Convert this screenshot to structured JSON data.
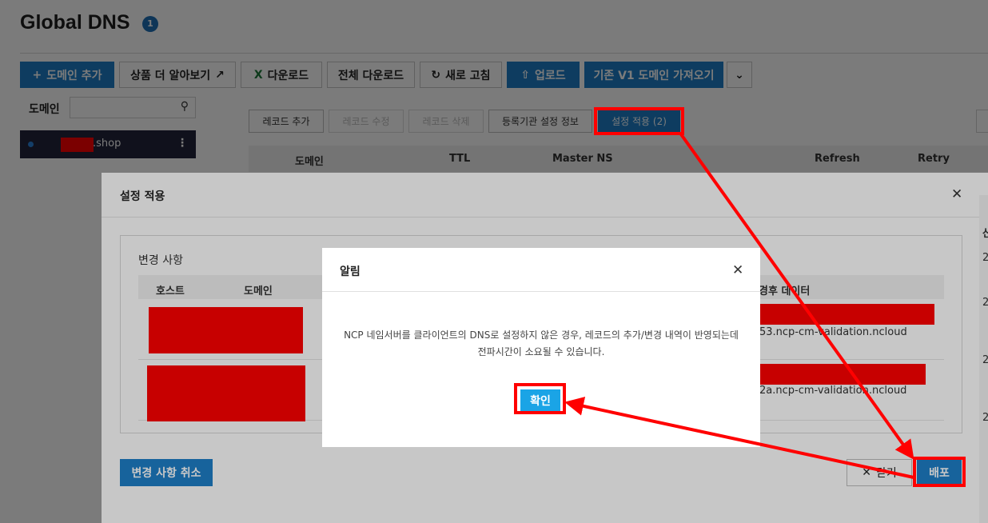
{
  "header": {
    "title": "Global DNS",
    "badge": "1"
  },
  "toolbar": {
    "add_domain": "도메인 추가",
    "learn_more": "상품 더 알아보기",
    "download": "다운로드",
    "download_all": "전체 다운로드",
    "refresh": "새로 고침",
    "upload": "업로드",
    "import_v1": "기존 V1 도메인 가져오기"
  },
  "sidebar": {
    "label": "도메인",
    "search_placeholder": "",
    "items": [
      {
        "suffix": ".shop"
      }
    ]
  },
  "records": {
    "buttons": {
      "add": "레코드 추가",
      "edit": "레코드 수정",
      "delete": "레코드 삭제",
      "registrar": "등록기관 설정 정보",
      "apply": "설정 적용 (2)"
    },
    "columns": [
      "도메인",
      "TTL",
      "Master NS",
      "Refresh",
      "Retry"
    ]
  },
  "apply_modal": {
    "title": "설정 적용",
    "changes_title": "변경 사항",
    "columns": {
      "host": "호스트",
      "domain": "도메인",
      "after_data": "경후 데이터"
    },
    "rows": [
      {
        "data": "53.ncp-cm-validation.ncloud"
      },
      {
        "data": "2a.ncp-cm-validation.ncloud"
      }
    ],
    "right_col_header": "산",
    "right_col_values": [
      "2",
      "2",
      "2",
      "2"
    ],
    "undo": "변경 사항 취소",
    "close": "닫기",
    "deploy": "배포"
  },
  "alert": {
    "title": "알림",
    "line1": "NCP 네임서버를 클라이언트의 DNS로 설정하지 않은 경우, 레코드의 추가/변경 내역이 반영되는데",
    "line2": "전파시간이 소요될 수 있습니다.",
    "ok": "확인"
  },
  "colors": {
    "primary": "#1e7fc8",
    "annotation": "#ff0000",
    "sidebar_item": "#22253b"
  }
}
